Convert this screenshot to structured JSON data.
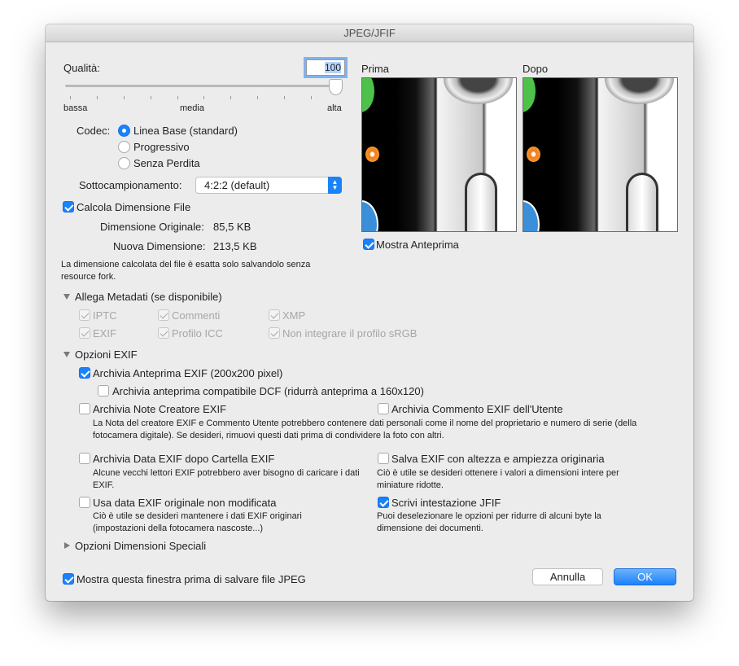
{
  "window": {
    "title": "JPEG/JFIF"
  },
  "quality": {
    "label": "Qualità:",
    "value": "100",
    "slider_value": 100,
    "slider_min_label": "bassa",
    "slider_mid_label": "media",
    "slider_max_label": "alta"
  },
  "codec": {
    "label": "Codec:",
    "options": [
      "Linea Base (standard)",
      "Progressivo",
      "Senza Perdita"
    ],
    "selected": "Linea Base (standard)"
  },
  "subsampling": {
    "label": "Sottocampionamento:",
    "value": "4:2:2 (default)"
  },
  "filesize": {
    "checkbox_label": "Calcola Dimensione File",
    "checked": true,
    "original_label": "Dimensione Originale:",
    "original_value": "85,5 KB",
    "new_label": "Nuova Dimensione:",
    "new_value": "213,5 KB",
    "note": "La dimensione calcolata del file è esatta solo salvandolo senza resource fork."
  },
  "preview": {
    "before_label": "Prima",
    "after_label": "Dopo",
    "show_label": "Mostra Anteprima",
    "show_checked": true
  },
  "metadata": {
    "label": "Allega Metadati (se disponibile)",
    "items": [
      "IPTC",
      "Commenti",
      "XMP",
      "EXIF",
      "Profilo ICC",
      "Non integrare il profilo sRGB"
    ]
  },
  "exif": {
    "label": "Opzioni EXIF",
    "thumb": "Archivia Anteprima EXIF (200x200 pixel)",
    "dcf": "Archivia anteprima compatibile DCF (ridurrà anteprima a 160x120)",
    "maker": "Archivia Note Creatore EXIF",
    "user_comment": "Archivia Commento EXIF dell'Utente",
    "privacy_note": "La Nota del creatore EXIF e Commento Utente potrebbero contenere dati personali come il nome del proprietario e numero di serie (della fotocamera digitale). Se desideri, rimuovi questi dati prima di condividere la foto con altri.",
    "date_after": "Archivia Data EXIF dopo Cartella EXIF",
    "date_after_note": "Alcune vecchi lettori EXIF potrebbero aver bisogno di caricare i dati EXIF.",
    "orig_size": "Salva EXIF con altezza e ampiezza originaria",
    "orig_size_note": "Ciò è utile se desideri ottenere i valori a dimensioni intere per miniature ridotte.",
    "orig_date": "Usa data EXIF originale non modificata",
    "orig_date_note": "Ciò è utile se desideri mantenere i dati EXIF originari (impostazioni della fotocamera nascoste...)",
    "jfif": "Scrivi intestazione JFIF",
    "jfif_note": "Puoi deselezionare le opzioni per ridurre di alcuni byte la dimensione dei documenti."
  },
  "special": {
    "label": "Opzioni Dimensioni Speciali"
  },
  "footer": {
    "show_dialog": "Mostra questa finestra prima di salvare file JPEG",
    "cancel": "Annulla",
    "ok": "OK"
  },
  "colors": {
    "accent": "#1a82fb"
  }
}
